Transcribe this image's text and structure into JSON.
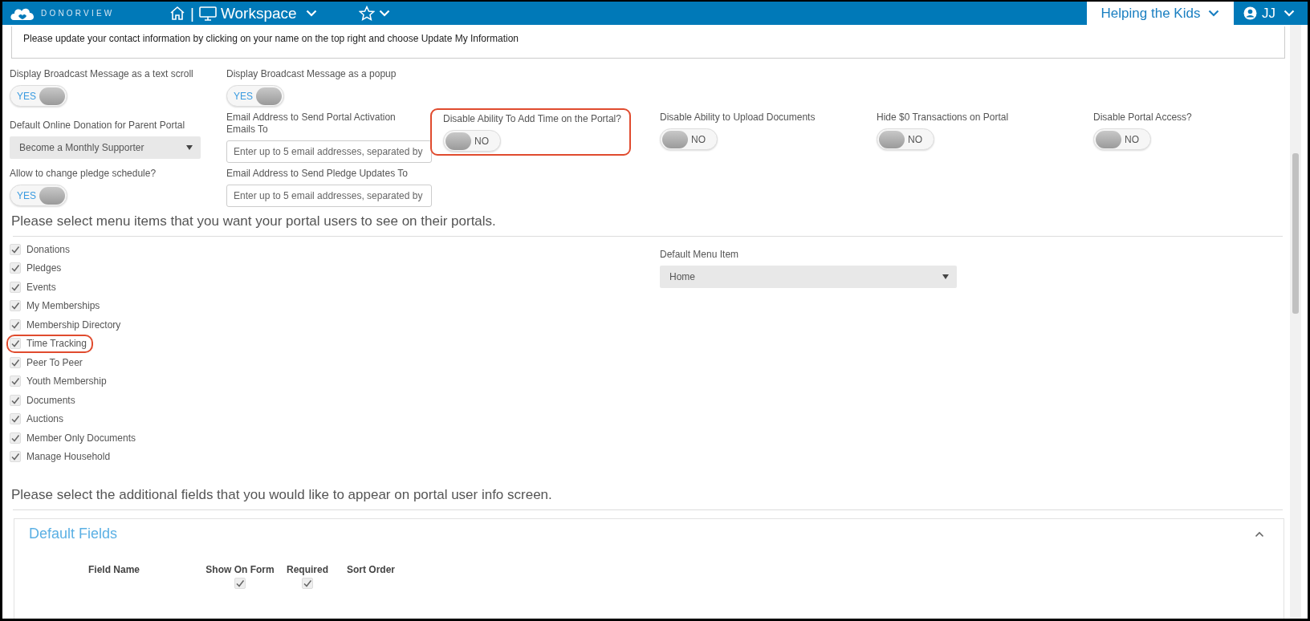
{
  "top_bar": {
    "logo_text": "DONORVIEW",
    "separator": "|",
    "workspace": "Workspace",
    "organization": "Helping the Kids",
    "user": "JJ"
  },
  "broadcast_message": {
    "value": "Please update your contact information by clicking on your name on the top right and choose Update My Information"
  },
  "settings_rows": [
    [
      {
        "kind": "toggle",
        "label": "Display Broadcast Message as a text scroll",
        "on": true,
        "state_text": "YES",
        "highlighted": false
      },
      {
        "kind": "toggle",
        "label": "Display Broadcast Message as a popup",
        "on": true,
        "state_text": "YES",
        "highlighted": false
      }
    ],
    [
      {
        "kind": "select",
        "label": "Default Online Donation for Parent Portal",
        "value": "Become a Monthly Supporter",
        "highlighted": false
      },
      {
        "kind": "email",
        "label": "Email Address to Send Portal Activation Emails To",
        "placeholder": "Enter up to 5 email addresses, separated by",
        "highlighted": false
      },
      {
        "kind": "toggle",
        "label": "Disable Ability To Add Time on the Portal?",
        "on": false,
        "state_text": "NO",
        "highlighted": true
      },
      {
        "kind": "toggle",
        "label": "Disable Ability to Upload Documents",
        "on": false,
        "state_text": "NO",
        "highlighted": false
      },
      {
        "kind": "toggle",
        "label": "Hide $0 Transactions on Portal",
        "on": false,
        "state_text": "NO",
        "highlighted": false
      },
      {
        "kind": "toggle",
        "label": "Disable Portal Access?",
        "on": false,
        "state_text": "NO",
        "highlighted": false
      }
    ],
    [
      {
        "kind": "toggle",
        "label": "Allow to change pledge schedule?",
        "on": true,
        "state_text": "YES",
        "highlighted": false
      },
      {
        "kind": "email",
        "label": "Email Address to Send Pledge Updates To",
        "placeholder": "Enter up to 5 email addresses, separated by",
        "highlighted": false
      }
    ]
  ],
  "menu_section": {
    "heading": "Please select menu items that you want your portal users to see on their portals.",
    "items": [
      {
        "label": "Donations",
        "checked": true,
        "highlighted": false
      },
      {
        "label": "Pledges",
        "checked": true,
        "highlighted": false
      },
      {
        "label": "Events",
        "checked": true,
        "highlighted": false
      },
      {
        "label": "My Memberships",
        "checked": true,
        "highlighted": false
      },
      {
        "label": "Membership Directory",
        "checked": true,
        "highlighted": false
      },
      {
        "label": "Time Tracking",
        "checked": true,
        "highlighted": true
      },
      {
        "label": "Peer To Peer",
        "checked": true,
        "highlighted": false
      },
      {
        "label": "Youth Membership",
        "checked": true,
        "highlighted": false
      },
      {
        "label": "Documents",
        "checked": true,
        "highlighted": false
      },
      {
        "label": "Auctions",
        "checked": true,
        "highlighted": false
      },
      {
        "label": "Member Only Documents",
        "checked": true,
        "highlighted": false
      },
      {
        "label": "Manage Household",
        "checked": true,
        "highlighted": false
      }
    ],
    "default_menu_item": {
      "label": "Default Menu Item",
      "value": "Home"
    }
  },
  "fields_section": {
    "heading": "Please select the additional fields that you would like to appear on portal user info screen.",
    "panel": {
      "title": "Default Fields",
      "expanded": true,
      "columns": [
        "Field Name",
        "Show On Form",
        "Required",
        "Sort Order"
      ],
      "rows": [
        {
          "show_on_form": true,
          "required": true
        }
      ]
    }
  }
}
